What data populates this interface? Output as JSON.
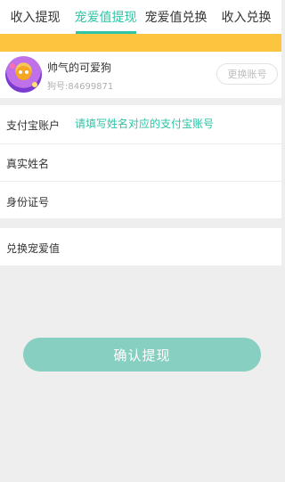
{
  "tabs": [
    {
      "label": "收入提现",
      "active": false
    },
    {
      "label": "宠爱值提现",
      "active": true
    },
    {
      "label": "宠爱值兑换",
      "active": false
    },
    {
      "label": "收入兑换",
      "active": false
    }
  ],
  "account": {
    "nickname": "帅气的可爱狗",
    "user_id": "狗号:84699871",
    "switch_label": "更换账号"
  },
  "form": {
    "alipay_label": "支付宝账户",
    "alipay_placeholder": "请填写姓名对应的支付宝账号",
    "realname_label": "真实姓名",
    "idcard_label": "身份证号",
    "exchange_label": "兑换宠爱值"
  },
  "confirm_label": "确认提现",
  "colors": {
    "accent": "#2ec4a5",
    "banner": "#fcc43f",
    "button": "#86cfc1",
    "background": "#eeeeee"
  }
}
